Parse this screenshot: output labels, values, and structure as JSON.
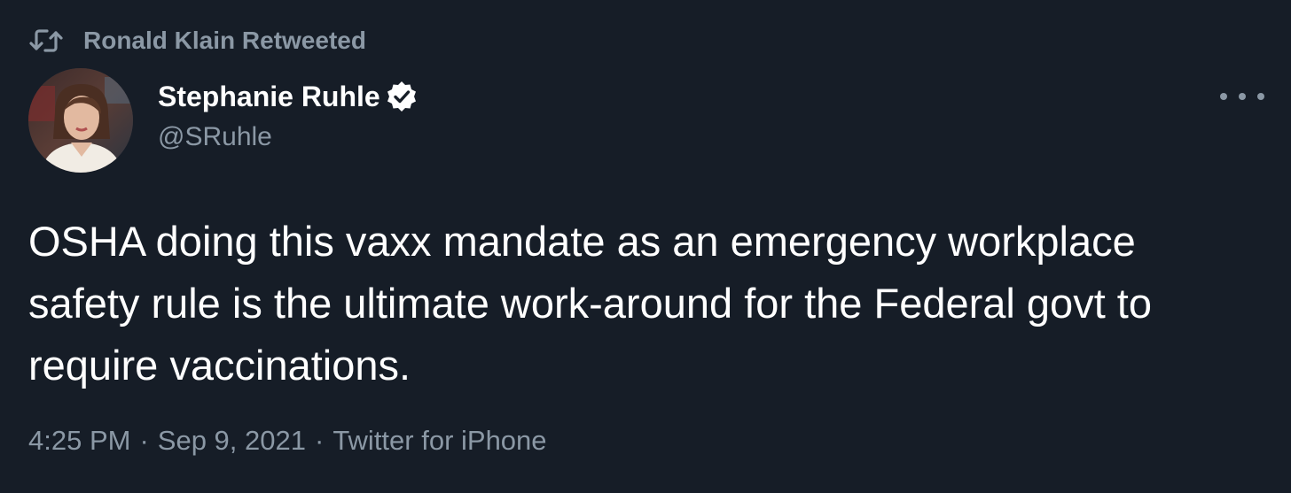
{
  "retweet": {
    "icon": "retweet-icon",
    "text": "Ronald Klain Retweeted"
  },
  "author": {
    "display_name": "Stephanie Ruhle",
    "handle": "@SRuhle",
    "verified": true,
    "verified_icon": "verified-badge-icon",
    "avatar_icon": "avatar"
  },
  "menu_icon": "more-options-icon",
  "tweet": {
    "text": "OSHA doing this vaxx mandate as an emergency workplace safety rule is the ultimate work-around for the Federal govt to require vaccinations."
  },
  "meta": {
    "time": "4:25 PM",
    "separator": "·",
    "date": "Sep 9, 2021",
    "source": "Twitter for iPhone"
  },
  "colors": {
    "background": "#161d27",
    "primary_text": "#ffffff",
    "secondary_text": "#8b98a5"
  }
}
